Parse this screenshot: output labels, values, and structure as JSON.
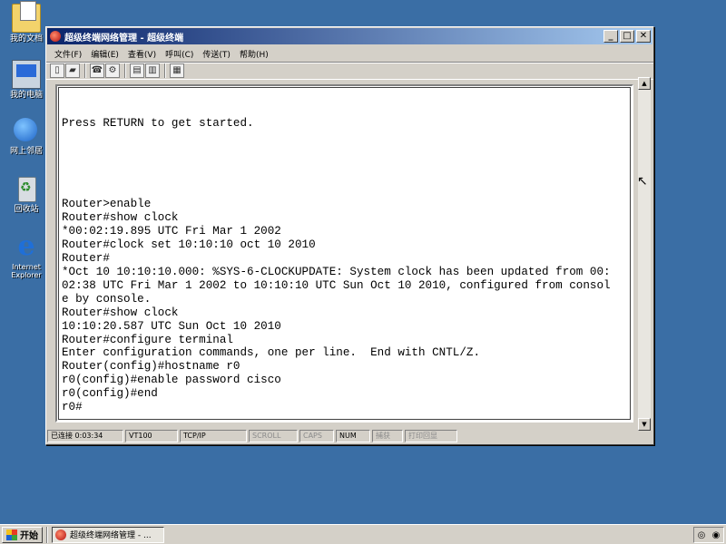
{
  "desktop_icons": [
    {
      "label": "我的文档",
      "icon": "my-documents-icon"
    },
    {
      "label": "我的电脑",
      "icon": "my-computer-icon"
    },
    {
      "label": "网上邻居",
      "icon": "network-places-icon"
    },
    {
      "label": "回收站",
      "icon": "recycle-bin-icon"
    },
    {
      "label": "Internet Explorer",
      "icon": "ie-icon"
    }
  ],
  "window": {
    "title": "超级终端网络管理 - 超级终端",
    "controls": {
      "minimize": "_",
      "maximize": "□",
      "close": "✕"
    }
  },
  "menu": [
    {
      "label": "文件(F)"
    },
    {
      "label": "编辑(E)"
    },
    {
      "label": "查看(V)"
    },
    {
      "label": "呼叫(C)"
    },
    {
      "label": "传送(T)"
    },
    {
      "label": "帮助(H)"
    }
  ],
  "toolbar_icons": [
    "new-icon",
    "open-icon",
    "disconnect-icon",
    "properties-icon",
    "send-icon",
    "receive-icon",
    "settings-icon"
  ],
  "terminal": {
    "lines": [
      "Press RETURN to get started.",
      "",
      "",
      "",
      "",
      "",
      "Router>enable",
      "Router#show clock",
      "*00:02:19.895 UTC Fri Mar 1 2002",
      "Router#clock set 10:10:10 oct 10 2010",
      "Router#",
      "*Oct 10 10:10:10.000: %SYS-6-CLOCKUPDATE: System clock has been updated from 00:",
      "02:38 UTC Fri Mar 1 2002 to 10:10:10 UTC Sun Oct 10 2010, configured from consol",
      "e by console.",
      "Router#show clock",
      "10:10:20.587 UTC Sun Oct 10 2010",
      "Router#configure terminal",
      "Enter configuration commands, one per line.  End with CNTL/Z.",
      "Router(config)#hostname r0",
      "r0(config)#enable password cisco",
      "r0(config)#end",
      "r0#"
    ]
  },
  "statusbar": {
    "connected": "已连接 0:03:34",
    "emulation": "VT100",
    "protocol": "TCP/IP",
    "scroll": "SCROLL",
    "caps": "CAPS",
    "num": "NUM",
    "capture": "捕获",
    "print_echo": "打印回显"
  },
  "taskbar": {
    "start_label": "开始",
    "task_label": "超级终端网络管理 - ..."
  }
}
